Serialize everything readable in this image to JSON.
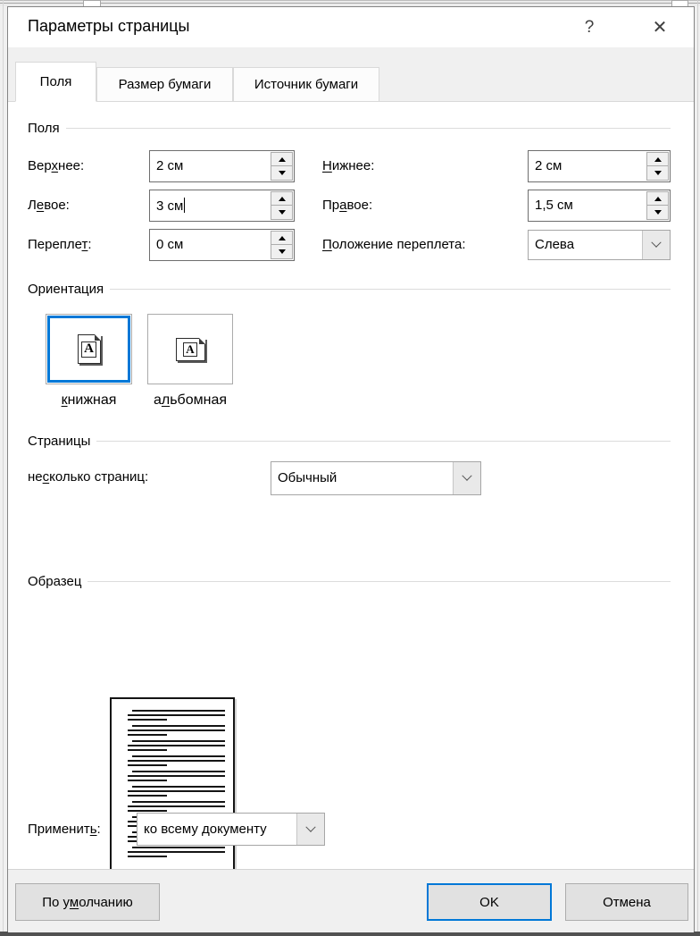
{
  "colors": {
    "accent": "#0078d7"
  },
  "dialog": {
    "title": "Параметры страницы",
    "help_glyph": "?",
    "close_glyph": "✕"
  },
  "tabs": [
    {
      "label": "Поля",
      "active": true
    },
    {
      "label": "Размер бумаги",
      "active": false
    },
    {
      "label": "Источник бумаги",
      "active": false
    }
  ],
  "margins": {
    "group_label": "Поля",
    "top": {
      "label": {
        "pre": "Вер",
        "key": "х",
        "post": "нее:"
      },
      "value": "2 см"
    },
    "bottom": {
      "label": {
        "pre": "",
        "key": "Н",
        "post": "ижнее:"
      },
      "value": "2 см"
    },
    "left": {
      "label": {
        "pre": "Л",
        "key": "е",
        "post": "вое:"
      },
      "value": "3 см"
    },
    "right": {
      "label": {
        "pre": "Пр",
        "key": "а",
        "post": "вое:"
      },
      "value": "1,5 см"
    },
    "gutter": {
      "label": {
        "pre": "Перепле",
        "key": "т",
        "post": ":"
      },
      "value": "0 см"
    },
    "gutter_position": {
      "label": {
        "pre": "",
        "key": "П",
        "post": "оложение переплета:"
      },
      "value": "Слева"
    }
  },
  "orientation": {
    "group_label": "Ориентация",
    "icon_letter": "A",
    "portrait": {
      "label": {
        "pre": "",
        "key": "к",
        "post": "нижная"
      },
      "selected": true
    },
    "landscape": {
      "label": {
        "pre": "а",
        "key": "л",
        "post": "ьбомная"
      },
      "selected": false
    }
  },
  "pages": {
    "group_label": "Страницы",
    "multiple_pages_label": {
      "pre": "не",
      "key": "с",
      "post": "колько страниц:"
    },
    "value": "Обычный"
  },
  "preview": {
    "group_label": "Образец",
    "paragraph_count": 10
  },
  "apply": {
    "label": {
      "pre": "Применит",
      "key": "ь",
      "post": ":"
    },
    "value": "ко всему документу"
  },
  "footer": {
    "default_button": {
      "pre": "По у",
      "key": "м",
      "post": "олчанию"
    },
    "ok_label": "OK",
    "cancel_label": "Отмена"
  }
}
